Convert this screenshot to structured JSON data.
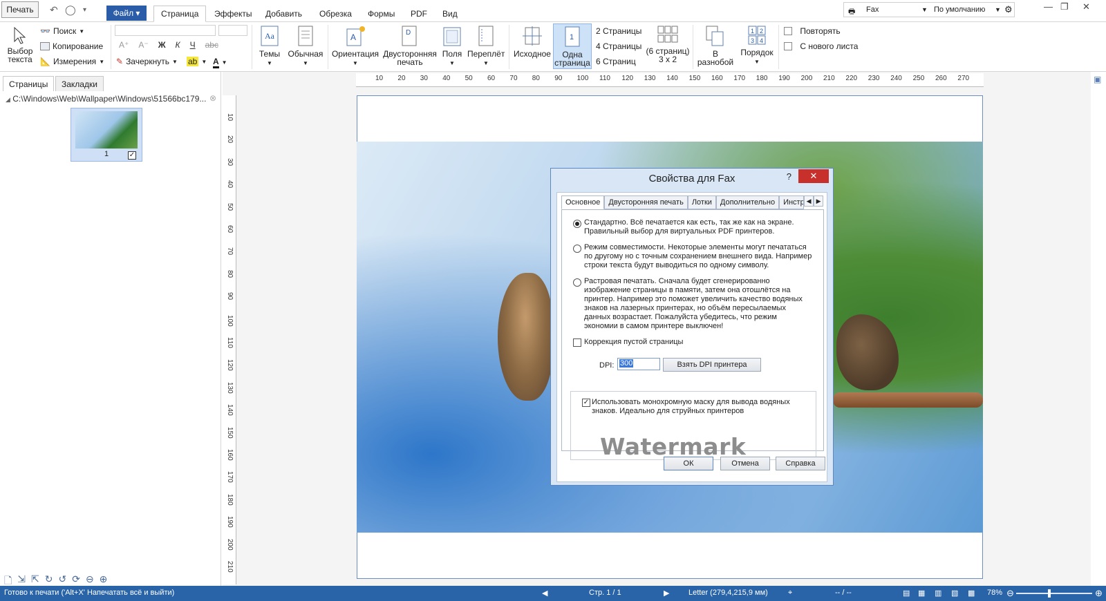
{
  "menubar": {
    "print_label": "Печать",
    "file_label": "Файл",
    "tabs": [
      "Страница",
      "Эффекты",
      "Добавить",
      "Обрезка",
      "Формы",
      "PDF",
      "Вид"
    ],
    "printer": "Fax",
    "profile": "По умолчанию"
  },
  "ribbon": {
    "select_text": "Выбор текста",
    "search": "Поиск",
    "copy": "Копирование",
    "measure": "Измерения",
    "bold": "Ж",
    "italic": "К",
    "underline": "Ч",
    "strike_sample": "abc",
    "strike_label": "Зачеркнуть",
    "themes": "Темы",
    "normal": "Обычная",
    "orientation": "Ориентация",
    "duplex": "Двусторонняя печать",
    "margins": "Поля",
    "binding": "Переплёт",
    "original": "Исходное",
    "one_page": "Одна страница",
    "two_pages": "2 Страницы",
    "four_pages": "4 Страницы",
    "six_pages": "6 Страниц",
    "six_grid": "(6 страниц) 3 x 2",
    "mixed": "В разнобой",
    "order": "Порядок",
    "repeat": "Повторять",
    "new_sheet": "С нового листа"
  },
  "leftpanel": {
    "tab_pages": "Страницы",
    "tab_bookmarks": "Закладки",
    "path": "C:\\Windows\\Web\\Wallpaper\\Windows\\51566bc179...",
    "thumb_num": "1"
  },
  "hruler_ticks": [
    "10",
    "20",
    "30",
    "40",
    "50",
    "60",
    "70",
    "80",
    "90",
    "100",
    "110",
    "120",
    "130",
    "140",
    "150",
    "160",
    "170",
    "180",
    "190",
    "200",
    "210",
    "220",
    "230",
    "240",
    "250",
    "260",
    "270"
  ],
  "vruler_ticks": [
    "10",
    "20",
    "30",
    "40",
    "50",
    "60",
    "70",
    "80",
    "90",
    "100",
    "110",
    "120",
    "130",
    "140",
    "150",
    "160",
    "170",
    "180",
    "190",
    "200",
    "210"
  ],
  "dialog": {
    "title": "Свойства для Fax",
    "help": "?",
    "close": "✕",
    "tabs": [
      "Основное",
      "Двусторонняя печать",
      "Лотки",
      "Дополнительно",
      "Инстр"
    ],
    "opt1": "Стандартно. Всё печатается как есть, так же как на экране. Правильный выбор для виртуальных PDF принтеров.",
    "opt2": "Режим совместимости. Некоторые элементы могут печататься по другому но с точным сохранением внешнего вида. Например строки текста будут выводиться по одному символу.",
    "opt3": "Растровая печатать. Сначала будет сгенерированно изображение страницы в памяти, затем она отошлётся на принтер. Например это поможет увеличить качество водяных знаков на лазерных принтерах, но объём пересылаемых данных возрастает. Пожалуйста убедитесь, что режим экономии в самом принтере выключен!",
    "blank_fix": "Коррекция пустой страницы",
    "dpi_label": "DPI:",
    "dpi_value": "300",
    "dpi_button": "Взять DPI принтера",
    "mono_mask": "Использовать монохромную маску для вывода водяных знаков. Идеально для струйных принтеров",
    "watermark": "Watermark",
    "ok": "ОК",
    "cancel": "Отмена",
    "help_btn": "Справка"
  },
  "status": {
    "ready": "Готово к печати ('Alt+X' Напечатать всё и выйти)",
    "page": "Стр. 1 / 1",
    "paper": "Letter (279,4,215,9 мм)",
    "coords": "-- / --",
    "zoom": "78%"
  }
}
